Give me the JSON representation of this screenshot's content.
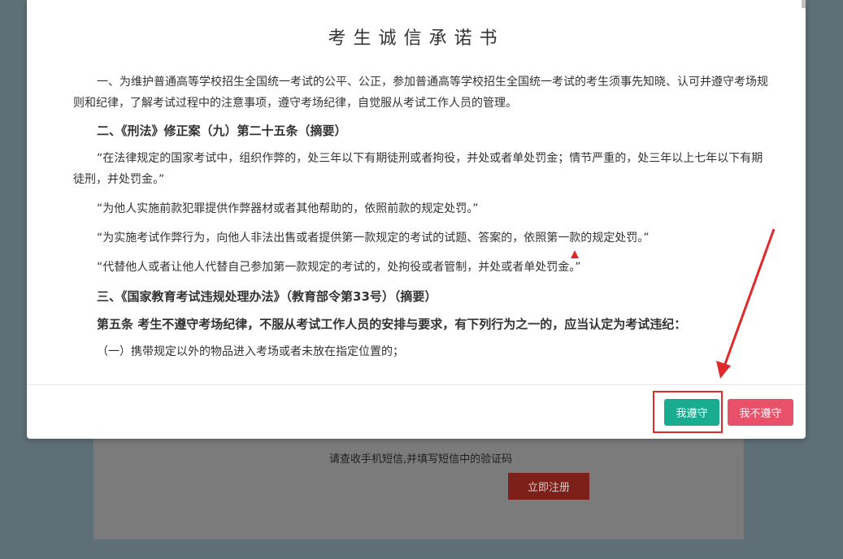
{
  "background": {
    "sms_hint": "请查收手机短信,并填写短信中的验证码",
    "register_button": "立即注册"
  },
  "modal": {
    "title": "考生诚信承诺书",
    "paragraphs": {
      "p1": "一、为维护普通高等学校招生全国统一考试的公平、公正，参加普通高等学校招生全国统一考试的考生须事先知晓、认可并遵守考场规则和纪律，了解考试过程中的注意事项，遵守考场纪律，自觉服从考试工作人员的管理。",
      "h2": "二、《刑法》修正案（九）第二十五条（摘要）",
      "q1": "“在法律规定的国家考试中，组织作弊的，处三年以下有期徒刑或者拘役，并处或者单处罚金；情节严重的，处三年以上七年以下有期徒刑，并处罚金。”",
      "q2": "“为他人实施前款犯罪提供作弊器材或者其他帮助的，依照前款的规定处罚。”",
      "q3": "“为实施考试作弊行为，向他人非法出售或者提供第一款规定的考试的试题、答案的，依照第一款的规定处罚。”",
      "q4": "“代替他人或者让他人代替自己参加第一款规定的考试的，处拘役或者管制，并处或者单处罚金。”",
      "h3": "三、《国家教育考试违规处理办法》（教育部令第33号）（摘要）",
      "h4": "第五条 考生不遵守考场纪律，不服从考试工作人员的安排与要求，有下列行为之一的，应当认定为考试违纪：",
      "item1": "（一）携带规定以外的物品进入考场或者未放在指定位置的；"
    },
    "buttons": {
      "agree": "我遵守",
      "disagree": "我不遵守"
    }
  },
  "colors": {
    "agree": "#1aac91",
    "disagree": "#e9516a",
    "annotation": "#e02a2a",
    "register": "#7c2019"
  }
}
